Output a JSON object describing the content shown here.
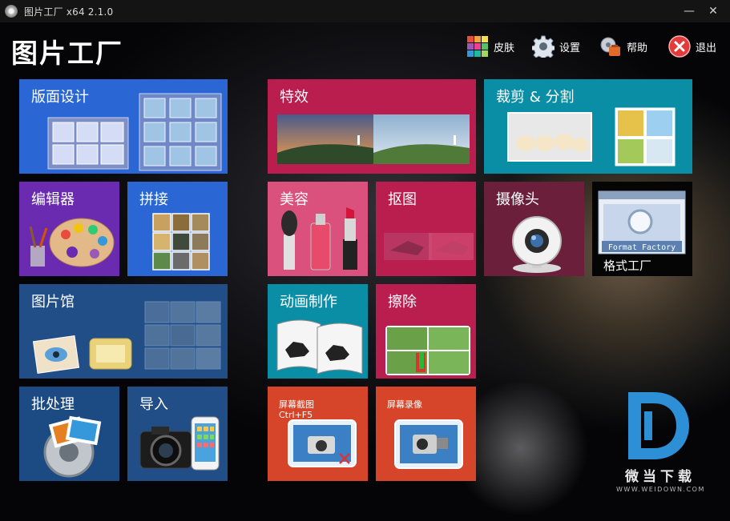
{
  "window": {
    "title": "图片工厂 x64 2.1.0",
    "minimize": "—",
    "close": "✕"
  },
  "header": {
    "app_name": "图片工厂",
    "actions": [
      {
        "label": "皮肤",
        "icon": "palette-grid-icon"
      },
      {
        "label": "设置",
        "icon": "gear-icon"
      },
      {
        "label": "帮助",
        "icon": "help-toolbox-icon"
      },
      {
        "label": "退出",
        "icon": "exit-icon"
      }
    ]
  },
  "tiles": {
    "layout_design": "版面设计",
    "editor": "编辑器",
    "stitch": "拼接",
    "gallery": "图片馆",
    "batch": "批处理",
    "import": "导入",
    "effects": "特效",
    "crop_split": "裁剪 & 分割",
    "beauty": "美容",
    "cutout": "抠图",
    "webcam": "摄像头",
    "format_factory": "格式工厂",
    "format_factory_box": "Format Factory",
    "animation": "动画制作",
    "erase": "擦除",
    "screen_capture": "屏幕截图",
    "screen_capture_shortcut": "Ctrl+F5",
    "screen_record": "屏幕录像"
  },
  "watermark": {
    "text": "微当下载",
    "url": "WWW.WEIDOWN.COM"
  },
  "colors": {
    "blue": "#2a66d4",
    "purple": "#6a2bb0",
    "navy": "#214e87",
    "crimson": "#b91e4f",
    "pink": "#d9517c",
    "teal": "#0a8ea6",
    "darkred": "#6b1f3a",
    "orange": "#d6452a"
  }
}
